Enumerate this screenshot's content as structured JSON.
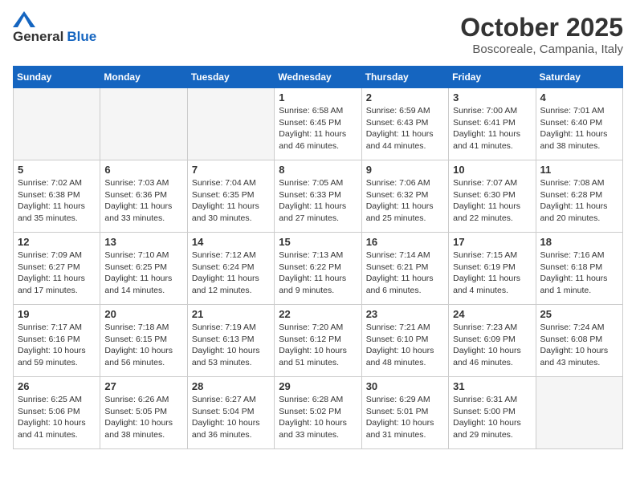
{
  "header": {
    "logo_general": "General",
    "logo_blue": "Blue",
    "month_title": "October 2025",
    "location": "Boscoreale, Campania, Italy"
  },
  "calendar": {
    "days_of_week": [
      "Sunday",
      "Monday",
      "Tuesday",
      "Wednesday",
      "Thursday",
      "Friday",
      "Saturday"
    ],
    "weeks": [
      [
        {
          "day": "",
          "info": ""
        },
        {
          "day": "",
          "info": ""
        },
        {
          "day": "",
          "info": ""
        },
        {
          "day": "1",
          "info": "Sunrise: 6:58 AM\nSunset: 6:45 PM\nDaylight: 11 hours\nand 46 minutes."
        },
        {
          "day": "2",
          "info": "Sunrise: 6:59 AM\nSunset: 6:43 PM\nDaylight: 11 hours\nand 44 minutes."
        },
        {
          "day": "3",
          "info": "Sunrise: 7:00 AM\nSunset: 6:41 PM\nDaylight: 11 hours\nand 41 minutes."
        },
        {
          "day": "4",
          "info": "Sunrise: 7:01 AM\nSunset: 6:40 PM\nDaylight: 11 hours\nand 38 minutes."
        }
      ],
      [
        {
          "day": "5",
          "info": "Sunrise: 7:02 AM\nSunset: 6:38 PM\nDaylight: 11 hours\nand 35 minutes."
        },
        {
          "day": "6",
          "info": "Sunrise: 7:03 AM\nSunset: 6:36 PM\nDaylight: 11 hours\nand 33 minutes."
        },
        {
          "day": "7",
          "info": "Sunrise: 7:04 AM\nSunset: 6:35 PM\nDaylight: 11 hours\nand 30 minutes."
        },
        {
          "day": "8",
          "info": "Sunrise: 7:05 AM\nSunset: 6:33 PM\nDaylight: 11 hours\nand 27 minutes."
        },
        {
          "day": "9",
          "info": "Sunrise: 7:06 AM\nSunset: 6:32 PM\nDaylight: 11 hours\nand 25 minutes."
        },
        {
          "day": "10",
          "info": "Sunrise: 7:07 AM\nSunset: 6:30 PM\nDaylight: 11 hours\nand 22 minutes."
        },
        {
          "day": "11",
          "info": "Sunrise: 7:08 AM\nSunset: 6:28 PM\nDaylight: 11 hours\nand 20 minutes."
        }
      ],
      [
        {
          "day": "12",
          "info": "Sunrise: 7:09 AM\nSunset: 6:27 PM\nDaylight: 11 hours\nand 17 minutes."
        },
        {
          "day": "13",
          "info": "Sunrise: 7:10 AM\nSunset: 6:25 PM\nDaylight: 11 hours\nand 14 minutes."
        },
        {
          "day": "14",
          "info": "Sunrise: 7:12 AM\nSunset: 6:24 PM\nDaylight: 11 hours\nand 12 minutes."
        },
        {
          "day": "15",
          "info": "Sunrise: 7:13 AM\nSunset: 6:22 PM\nDaylight: 11 hours\nand 9 minutes."
        },
        {
          "day": "16",
          "info": "Sunrise: 7:14 AM\nSunset: 6:21 PM\nDaylight: 11 hours\nand 6 minutes."
        },
        {
          "day": "17",
          "info": "Sunrise: 7:15 AM\nSunset: 6:19 PM\nDaylight: 11 hours\nand 4 minutes."
        },
        {
          "day": "18",
          "info": "Sunrise: 7:16 AM\nSunset: 6:18 PM\nDaylight: 11 hours\nand 1 minute."
        }
      ],
      [
        {
          "day": "19",
          "info": "Sunrise: 7:17 AM\nSunset: 6:16 PM\nDaylight: 10 hours\nand 59 minutes."
        },
        {
          "day": "20",
          "info": "Sunrise: 7:18 AM\nSunset: 6:15 PM\nDaylight: 10 hours\nand 56 minutes."
        },
        {
          "day": "21",
          "info": "Sunrise: 7:19 AM\nSunset: 6:13 PM\nDaylight: 10 hours\nand 53 minutes."
        },
        {
          "day": "22",
          "info": "Sunrise: 7:20 AM\nSunset: 6:12 PM\nDaylight: 10 hours\nand 51 minutes."
        },
        {
          "day": "23",
          "info": "Sunrise: 7:21 AM\nSunset: 6:10 PM\nDaylight: 10 hours\nand 48 minutes."
        },
        {
          "day": "24",
          "info": "Sunrise: 7:23 AM\nSunset: 6:09 PM\nDaylight: 10 hours\nand 46 minutes."
        },
        {
          "day": "25",
          "info": "Sunrise: 7:24 AM\nSunset: 6:08 PM\nDaylight: 10 hours\nand 43 minutes."
        }
      ],
      [
        {
          "day": "26",
          "info": "Sunrise: 6:25 AM\nSunset: 5:06 PM\nDaylight: 10 hours\nand 41 minutes."
        },
        {
          "day": "27",
          "info": "Sunrise: 6:26 AM\nSunset: 5:05 PM\nDaylight: 10 hours\nand 38 minutes."
        },
        {
          "day": "28",
          "info": "Sunrise: 6:27 AM\nSunset: 5:04 PM\nDaylight: 10 hours\nand 36 minutes."
        },
        {
          "day": "29",
          "info": "Sunrise: 6:28 AM\nSunset: 5:02 PM\nDaylight: 10 hours\nand 33 minutes."
        },
        {
          "day": "30",
          "info": "Sunrise: 6:29 AM\nSunset: 5:01 PM\nDaylight: 10 hours\nand 31 minutes."
        },
        {
          "day": "31",
          "info": "Sunrise: 6:31 AM\nSunset: 5:00 PM\nDaylight: 10 hours\nand 29 minutes."
        },
        {
          "day": "",
          "info": ""
        }
      ]
    ]
  }
}
